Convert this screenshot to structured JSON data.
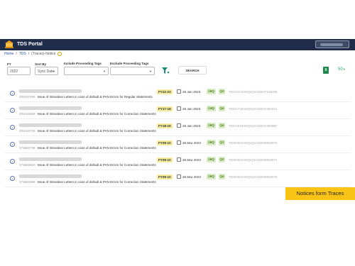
{
  "header": {
    "title": "TDS Portal"
  },
  "breadcrumb": {
    "home": "Home",
    "sep1": "/",
    "tds": "TDS",
    "sep2": "/",
    "current": "(Traces)-Notice"
  },
  "filters": {
    "fy_label": "FY",
    "fy_value": "2022",
    "sort_label": "Sort By",
    "sort_value": "Sync Date",
    "include_label": "Include Proceeding Tags",
    "exclude_label": "Exclude Proceeding Tags",
    "search_label": "SEARCH",
    "page_size": "50"
  },
  "notices": [
    {
      "ack": "302007485",
      "title": "Issue of Intimation Letters in case of default & PAN Errors for Regular Statements",
      "fy": "FY22-23",
      "date": "26 Jan 2023",
      "form": "26Q",
      "quarter": "Q3",
      "ref": "TDS/2223/26Q/Q3/100047168298"
    },
    {
      "ack": "302152052",
      "title": "Issue of Intimation Letters in case of default & PAN Errors for Correction Statements",
      "fy": "FY17-18",
      "date": "26 Jan 2023",
      "form": "24Q",
      "quarter": "Q4",
      "ref": "TDS/1718/24Q/Q4/100047481621"
    },
    {
      "ack": "302152745",
      "title": "Issue of Intimation Letters in case of default & PAN Errors for Correction Statements",
      "fy": "FY18-19",
      "date": "26 Jan 2023",
      "form": "26Q",
      "quarter": "Q4",
      "ref": "TDS/1819/26Q/Q4/100047483887"
    },
    {
      "ack": "373552746",
      "title": "Issue of Intimation Letters in case of default & PAN Errors for Correction Statements",
      "fy": "FY09-10",
      "date": "26 Mar 2023",
      "form": "26Q",
      "quarter": "Q1",
      "ref": "TDS/0910/26Q/Q1/100049818570"
    },
    {
      "ack": "373552810",
      "title": "Issue of Intimation Letters in case of default & PAN Errors for Correction Statements",
      "fy": "FY09-10",
      "date": "26 Mar 2023",
      "form": "26Q",
      "quarter": "Q2",
      "ref": "TDS/0910/26Q/Q2/100049818571"
    },
    {
      "ack": "373553266",
      "title": "Issue of Intimation Letters in case of default & PAN Errors for Correction Statements",
      "fy": "FY09-10",
      "date": "26 Mar 2023",
      "form": "26Q",
      "quarter": "Q4",
      "ref": "TDS/0910/26Q/Q4/100049818575"
    }
  ],
  "banner": {
    "text": "Notices form Traces"
  },
  "colors": {
    "topbar": "#1f2c4a",
    "fy_tag": "#f5eb9c",
    "form_tag": "#d9ecc2",
    "banner": "#f9c416",
    "accent_green": "#2ea36a"
  }
}
